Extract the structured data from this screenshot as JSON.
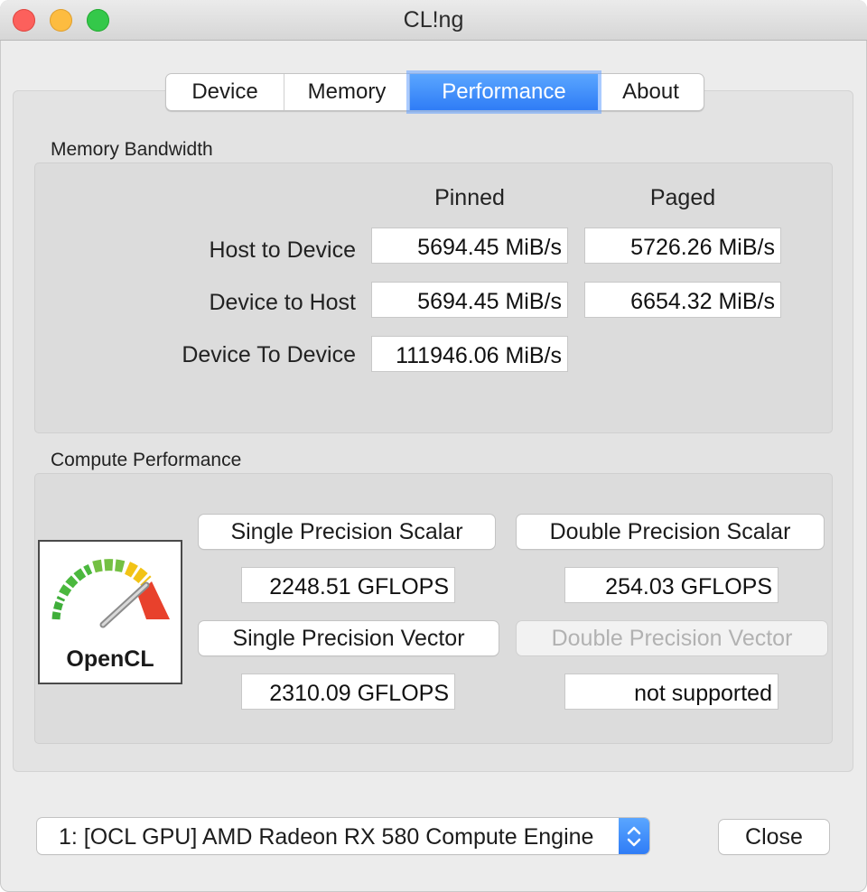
{
  "window": {
    "title": "CL!ng"
  },
  "tabs": [
    {
      "label": "Device"
    },
    {
      "label": "Memory"
    },
    {
      "label": "Performance"
    },
    {
      "label": "About"
    }
  ],
  "memory_bandwidth": {
    "title": "Memory Bandwidth",
    "columns": {
      "pinned": "Pinned",
      "paged": "Paged"
    },
    "rows": [
      {
        "label": "Host to Device",
        "pinned": "5694.45 MiB/s",
        "paged": "5726.26 MiB/s"
      },
      {
        "label": "Device to Host",
        "pinned": "5694.45 MiB/s",
        "paged": "6654.32 MiB/s"
      },
      {
        "label": "Device To Device",
        "pinned": "111946.06 MiB/s"
      }
    ]
  },
  "compute_performance": {
    "title": "Compute Performance",
    "logo_text": "OpenCL",
    "single_scalar": {
      "label": "Single Precision Scalar",
      "value": "2248.51 GFLOPS"
    },
    "double_scalar": {
      "label": "Double Precision Scalar",
      "value": "254.03 GFLOPS"
    },
    "single_vector": {
      "label": "Single Precision Vector",
      "value": "2310.09 GFLOPS"
    },
    "double_vector": {
      "label": "Double Precision Vector",
      "value": "not supported",
      "enabled": false
    }
  },
  "footer": {
    "device_select": "1: [OCL GPU] AMD Radeon RX 580 Compute Engine",
    "close_label": "Close"
  },
  "colors": {
    "accent": "#2f7cf6",
    "window_bg": "#ececec",
    "gauge_green": "#3fae3a",
    "gauge_yellow": "#f2c316",
    "gauge_red": "#e8412c"
  }
}
